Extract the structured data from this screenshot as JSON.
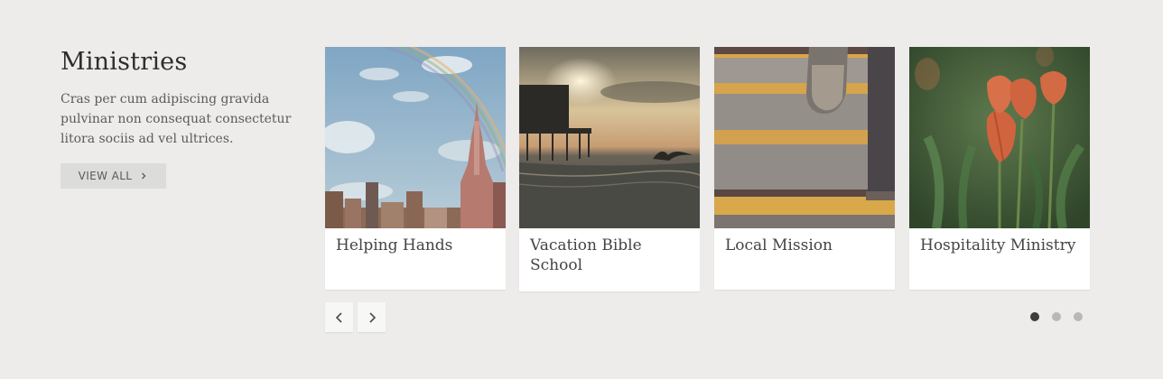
{
  "section": {
    "title": "Ministries",
    "description": "Cras per cum adipiscing gravida pulvinar non consequat consectetur litora sociis ad vel ultrices.",
    "view_all_label": "VIEW ALL"
  },
  "cards": [
    {
      "title": "Helping Hands"
    },
    {
      "title": "Vacation Bible School"
    },
    {
      "title": "Local Mission"
    },
    {
      "title": "Hospitality Ministry"
    }
  ],
  "pagination": {
    "active_index": 0,
    "total": 3
  },
  "colors": {
    "background": "#edecea",
    "card": "#ffffff",
    "button": "#dcdcda",
    "dot_active": "#3d3d3d",
    "dot_inactive": "#b9b8b6"
  },
  "icons": {
    "view_all": "chevron-right-icon",
    "prev": "chevron-left-icon",
    "next": "chevron-right-icon"
  }
}
